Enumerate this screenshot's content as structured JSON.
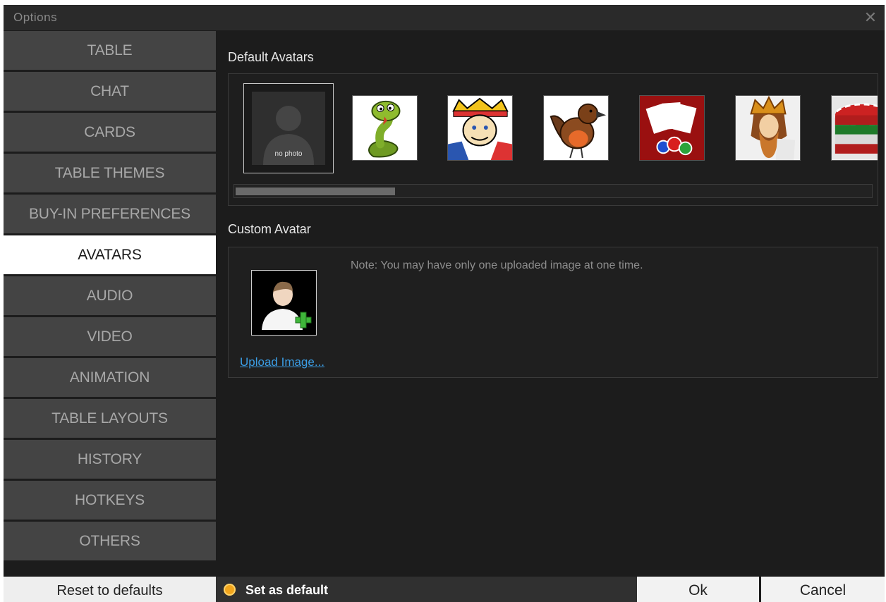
{
  "window": {
    "title": "Options"
  },
  "sidebar": {
    "items": [
      {
        "label": "TABLE"
      },
      {
        "label": "CHAT"
      },
      {
        "label": "CARDS"
      },
      {
        "label": "TABLE THEMES"
      },
      {
        "label": "BUY-IN PREFERENCES"
      },
      {
        "label": "AVATARS",
        "active": true
      },
      {
        "label": "AUDIO"
      },
      {
        "label": "VIDEO"
      },
      {
        "label": "ANIMATION"
      },
      {
        "label": "TABLE LAYOUTS"
      },
      {
        "label": "HISTORY"
      },
      {
        "label": "HOTKEYS"
      },
      {
        "label": "OTHERS"
      }
    ]
  },
  "default_avatars": {
    "title": "Default Avatars",
    "selected_label": "no photo",
    "items": [
      {
        "icon": "no-photo-icon",
        "selected": true
      },
      {
        "icon": "snake-icon"
      },
      {
        "icon": "king-card-icon"
      },
      {
        "icon": "bird-icon"
      },
      {
        "icon": "cards-and-chips-icon"
      },
      {
        "icon": "king-portrait-icon"
      },
      {
        "icon": "poker-chips-icon"
      }
    ]
  },
  "custom_avatar": {
    "title": "Custom Avatar",
    "note": "Note: You may have only one uploaded image at one time.",
    "upload_label": "Upload Image..."
  },
  "footer": {
    "reset_label": "Reset to defaults",
    "set_default_label": "Set as default",
    "ok_label": "Ok",
    "cancel_label": "Cancel"
  },
  "colors": {
    "accent_active_bg": "#ffffff",
    "nav_bg": "#444444",
    "link": "#3b9ee6",
    "radio": "#f1a51c"
  }
}
